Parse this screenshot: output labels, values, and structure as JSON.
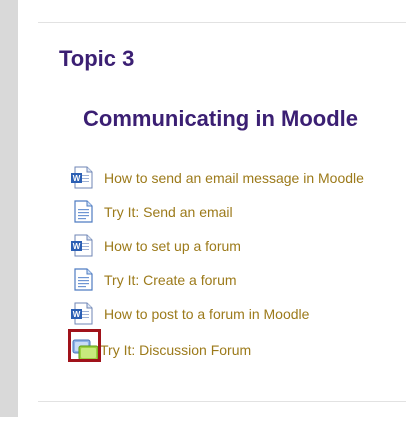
{
  "topic": {
    "title": "Topic 3",
    "heading": "Communicating in Moodle"
  },
  "activities": [
    {
      "label": "How to send an email message in Moodle",
      "icon": "word-document-icon"
    },
    {
      "label": "Try It: Send an email",
      "icon": "page-icon"
    },
    {
      "label": "How to set up a forum",
      "icon": "word-document-icon"
    },
    {
      "label": "Try It: Create a forum",
      "icon": "page-icon"
    },
    {
      "label": "How to post to a forum in Moodle",
      "icon": "word-document-icon"
    },
    {
      "label": "Try It: Discussion Forum",
      "icon": "forum-icon"
    }
  ],
  "colors": {
    "heading": "#3b1f73",
    "link": "#9c7a1a",
    "highlight_border": "#a0121a"
  }
}
